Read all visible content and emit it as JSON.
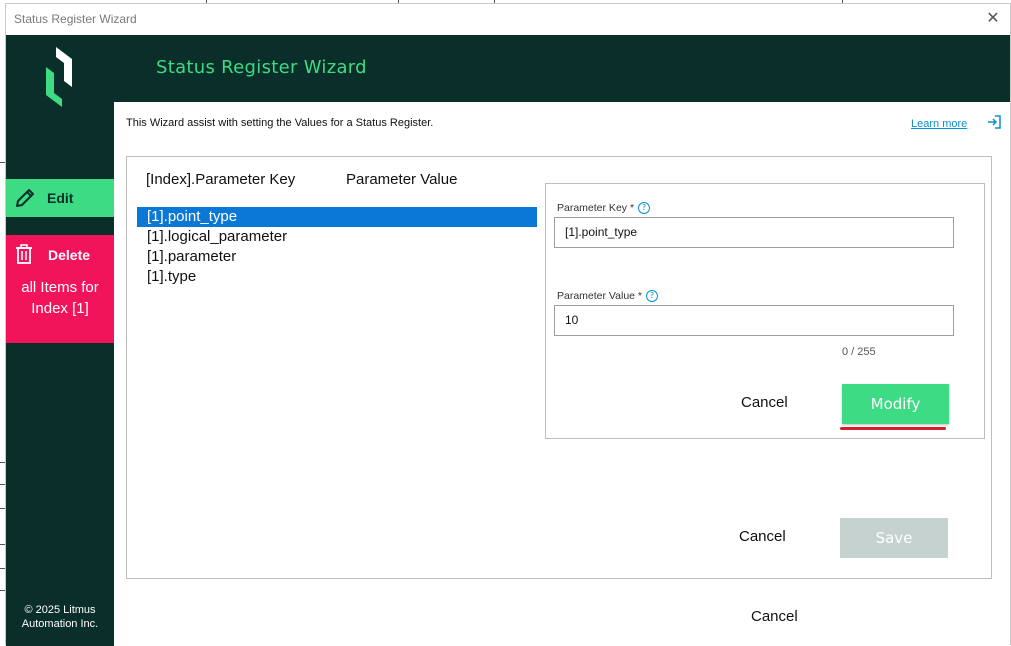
{
  "window": {
    "title": "Status Register Wizard",
    "close_glyph": "✕"
  },
  "header": {
    "title": "Status Register Wizard"
  },
  "sidebar": {
    "edit_label": "Edit",
    "delete_label": "Delete",
    "delete_sublabel": "all Items for Index [1]",
    "copyright": "© 2025 Litmus Automation Inc."
  },
  "intro": {
    "text": "This Wizard assist with setting the Values for a Status Register.",
    "learn_more": "Learn more"
  },
  "list": {
    "col_key": "[Index].Parameter Key",
    "col_value": "Parameter Value",
    "items": [
      {
        "label": "[1].point_type",
        "selected": true
      },
      {
        "label": "[1].logical_parameter",
        "selected": false
      },
      {
        "label": "[1].parameter",
        "selected": false
      },
      {
        "label": "[1].type",
        "selected": false
      }
    ]
  },
  "editor": {
    "key_label": "Parameter Key *",
    "key_value": "[1].point_type",
    "value_label": "Parameter Value *",
    "value_value": "10",
    "help_glyph": "?",
    "counter": "0 / 255",
    "cancel": "Cancel",
    "modify": "Modify"
  },
  "panel": {
    "cancel": "Cancel",
    "save": "Save"
  },
  "footer": {
    "cancel": "Cancel"
  },
  "colors": {
    "dark": "#0a2e29",
    "accent": "#3ddc84",
    "danger": "#f2145a",
    "selection": "#0a78d6",
    "link": "#0a8fd0"
  },
  "icons": {
    "logo": "litmus-logo",
    "edit": "pencil-icon",
    "delete": "trash-icon",
    "learn_more": "external-link-icon"
  }
}
